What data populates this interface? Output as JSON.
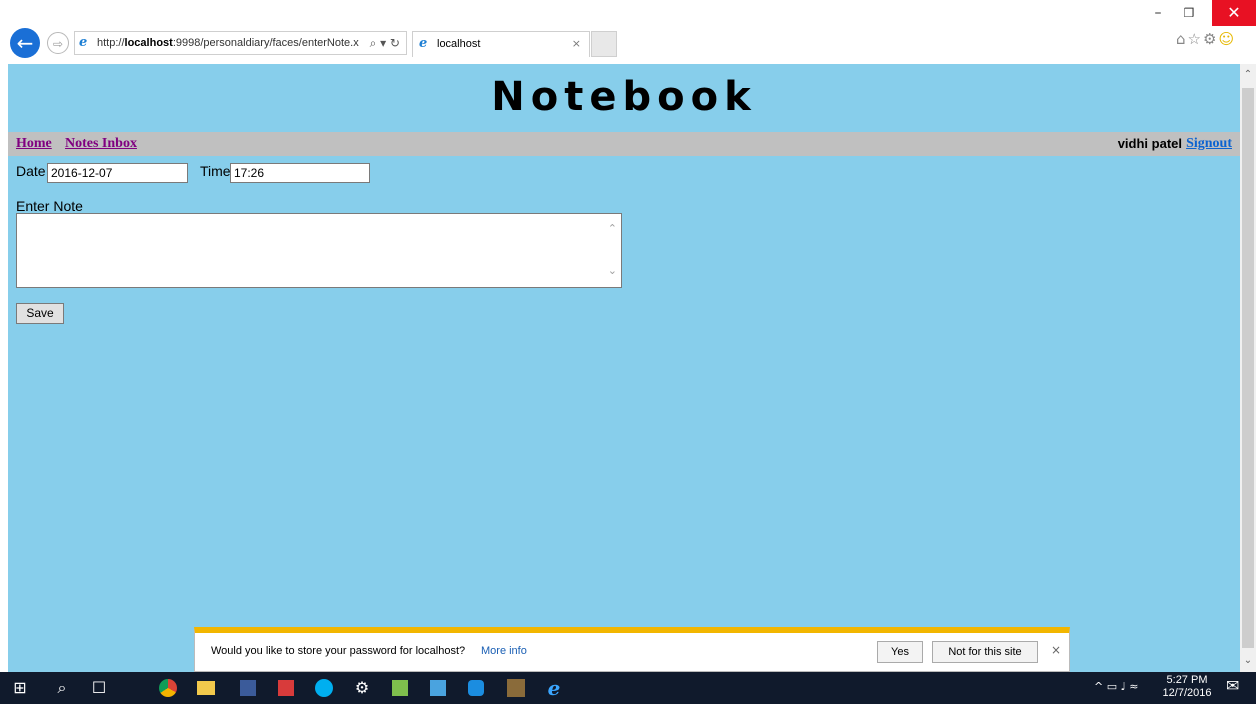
{
  "browser": {
    "url_prefix": "http://",
    "url_host": "localhost",
    "url_rest": ":9998/personaldiary/faces/enterNote.x",
    "url_tools": "⌕ ▾ ↻",
    "tab_title": "localhost",
    "tab_close": "×",
    "back_glyph": "←",
    "forward_glyph": "⇨",
    "ie_glyph": "e",
    "window": {
      "minimize": "–",
      "maximize": "❒",
      "close": "✕"
    },
    "toolbar_icons": {
      "home": "⌂",
      "favorites": "☆",
      "settings": "⚙",
      "feedback": "☺"
    }
  },
  "page": {
    "background": "#87ceeb",
    "heading": "Notebook",
    "nav": {
      "home": "Home",
      "inbox": "Notes Inbox",
      "user_name": "vidhi patel",
      "signout": "Signout"
    },
    "date_label": "Date",
    "date_value": "2016-12-07",
    "time_label": "Time",
    "time_value": "17:26",
    "note_label": "Enter Note",
    "note_value": "",
    "save_label": "Save"
  },
  "password_bar": {
    "message": "Would you like to store your password for localhost?",
    "more_info": "More info",
    "yes": "Yes",
    "not_for_site": "Not for this site",
    "close": "×"
  },
  "taskbar": {
    "start": "⊞",
    "search": "⌕",
    "taskview": "☐",
    "apps": [
      "chrome",
      "file-explorer",
      "app-badge",
      "app-red",
      "skype",
      "settings",
      "notepad",
      "box-app",
      "teamviewer",
      "game-app",
      "internet-explorer"
    ],
    "tray": "^ ▭ ♩ ≈",
    "time": "5:27 PM",
    "date": "12/7/2016",
    "notification_icon": "✉"
  },
  "colors": {
    "page_bg": "#87ceeb",
    "nav_bg": "#c0c0c0",
    "visited_link": "#800080",
    "link": "#0b63d1",
    "close_red": "#e81123",
    "password_accent": "#f2b600",
    "taskbar_bg": "#101a2c"
  }
}
